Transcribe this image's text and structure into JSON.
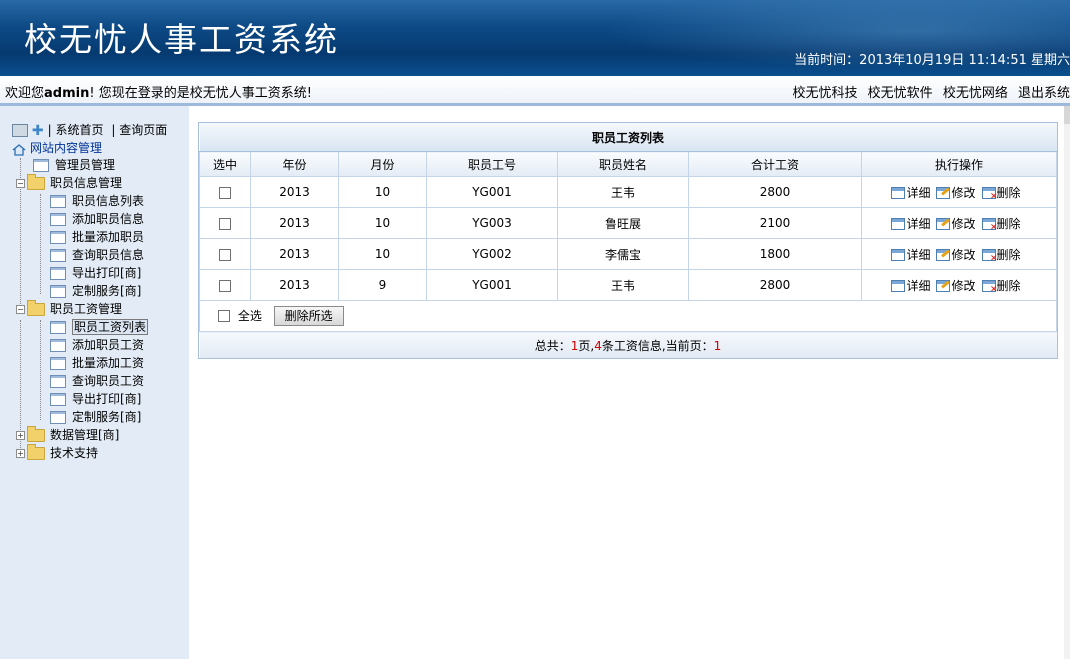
{
  "header": {
    "title": "校无忧人事工资系统",
    "time_label": "当前时间：2013年10月19日  11:14:51 星期六"
  },
  "welcome": {
    "prefix": "欢迎您",
    "user": "admin",
    "suffix": "! 您现在登录的是校无忧人事工资系统!",
    "links": [
      "校无忧科技",
      "校无忧软件",
      "校无忧网络",
      "退出系统"
    ]
  },
  "sidebar": {
    "top_links": [
      "| 系统首页",
      "| 查询页面"
    ],
    "root": "网站内容管理",
    "admin": "管理员管理",
    "groups": [
      {
        "label": "职员信息管理",
        "children": [
          "职员信息列表",
          "添加职员信息",
          "批量添加职员",
          "查询职员信息",
          "导出打印[商]",
          "定制服务[商]"
        ]
      },
      {
        "label": "职员工资管理",
        "children": [
          "职员工资列表",
          "添加职员工资",
          "批量添加工资",
          "查询职员工资",
          "导出打印[商]",
          "定制服务[商]"
        ]
      },
      {
        "label": "数据管理[商]",
        "children": []
      },
      {
        "label": "技术支持",
        "children": []
      }
    ],
    "selected": "职员工资列表"
  },
  "table": {
    "caption": "职员工资列表",
    "headers": [
      "选中",
      "年份",
      "月份",
      "职员工号",
      "职员姓名",
      "合计工资",
      "执行操作"
    ],
    "rows": [
      {
        "year": "2013",
        "month": "10",
        "id": "YG001",
        "name": "王韦",
        "total": "2800"
      },
      {
        "year": "2013",
        "month": "10",
        "id": "YG003",
        "name": "鲁旺展",
        "total": "2100"
      },
      {
        "year": "2013",
        "month": "10",
        "id": "YG002",
        "name": "李儒宝",
        "total": "1800"
      },
      {
        "year": "2013",
        "month": "9",
        "id": "YG001",
        "name": "王韦",
        "total": "2800"
      }
    ],
    "actions": {
      "detail": "详细",
      "edit": "修改",
      "delete": "删除"
    },
    "select_all": "全选",
    "delete_selected": "删除所选",
    "pager": {
      "t1": "总共：",
      "pages": "1",
      "t2": "页,",
      "count": "4",
      "t3": "条工资信息,当前页：",
      "current": "1"
    }
  }
}
